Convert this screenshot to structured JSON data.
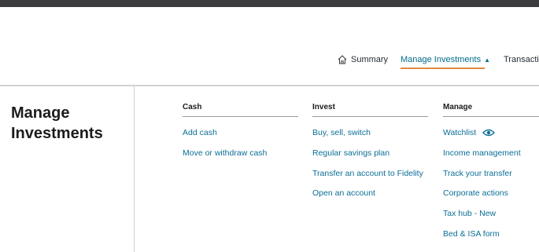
{
  "nav": {
    "summary": "Summary",
    "manage_investments": "Manage Investments",
    "transactions": "Transactio"
  },
  "panel": {
    "title": "Manage Investments",
    "columns": [
      {
        "heading": "Cash",
        "links": [
          "Add cash",
          "Move or withdraw cash"
        ]
      },
      {
        "heading": "Invest",
        "links": [
          "Buy, sell, switch",
          "Regular savings plan",
          "Transfer an account to Fidelity",
          "Open an account"
        ]
      },
      {
        "heading": "Manage",
        "links": [
          "Watchlist",
          "Income management",
          "Track your transfer",
          "Corporate actions",
          "Tax hub - New",
          "Bed & ISA form"
        ]
      }
    ]
  },
  "colors": {
    "link": "#0b6e96",
    "accent_underline": "#e58a3f",
    "top_bar": "#3c3c3e"
  },
  "icons": {
    "summary": "home-icon",
    "manage_investments": "chevron-up-icon",
    "watchlist": "eye-icon"
  }
}
